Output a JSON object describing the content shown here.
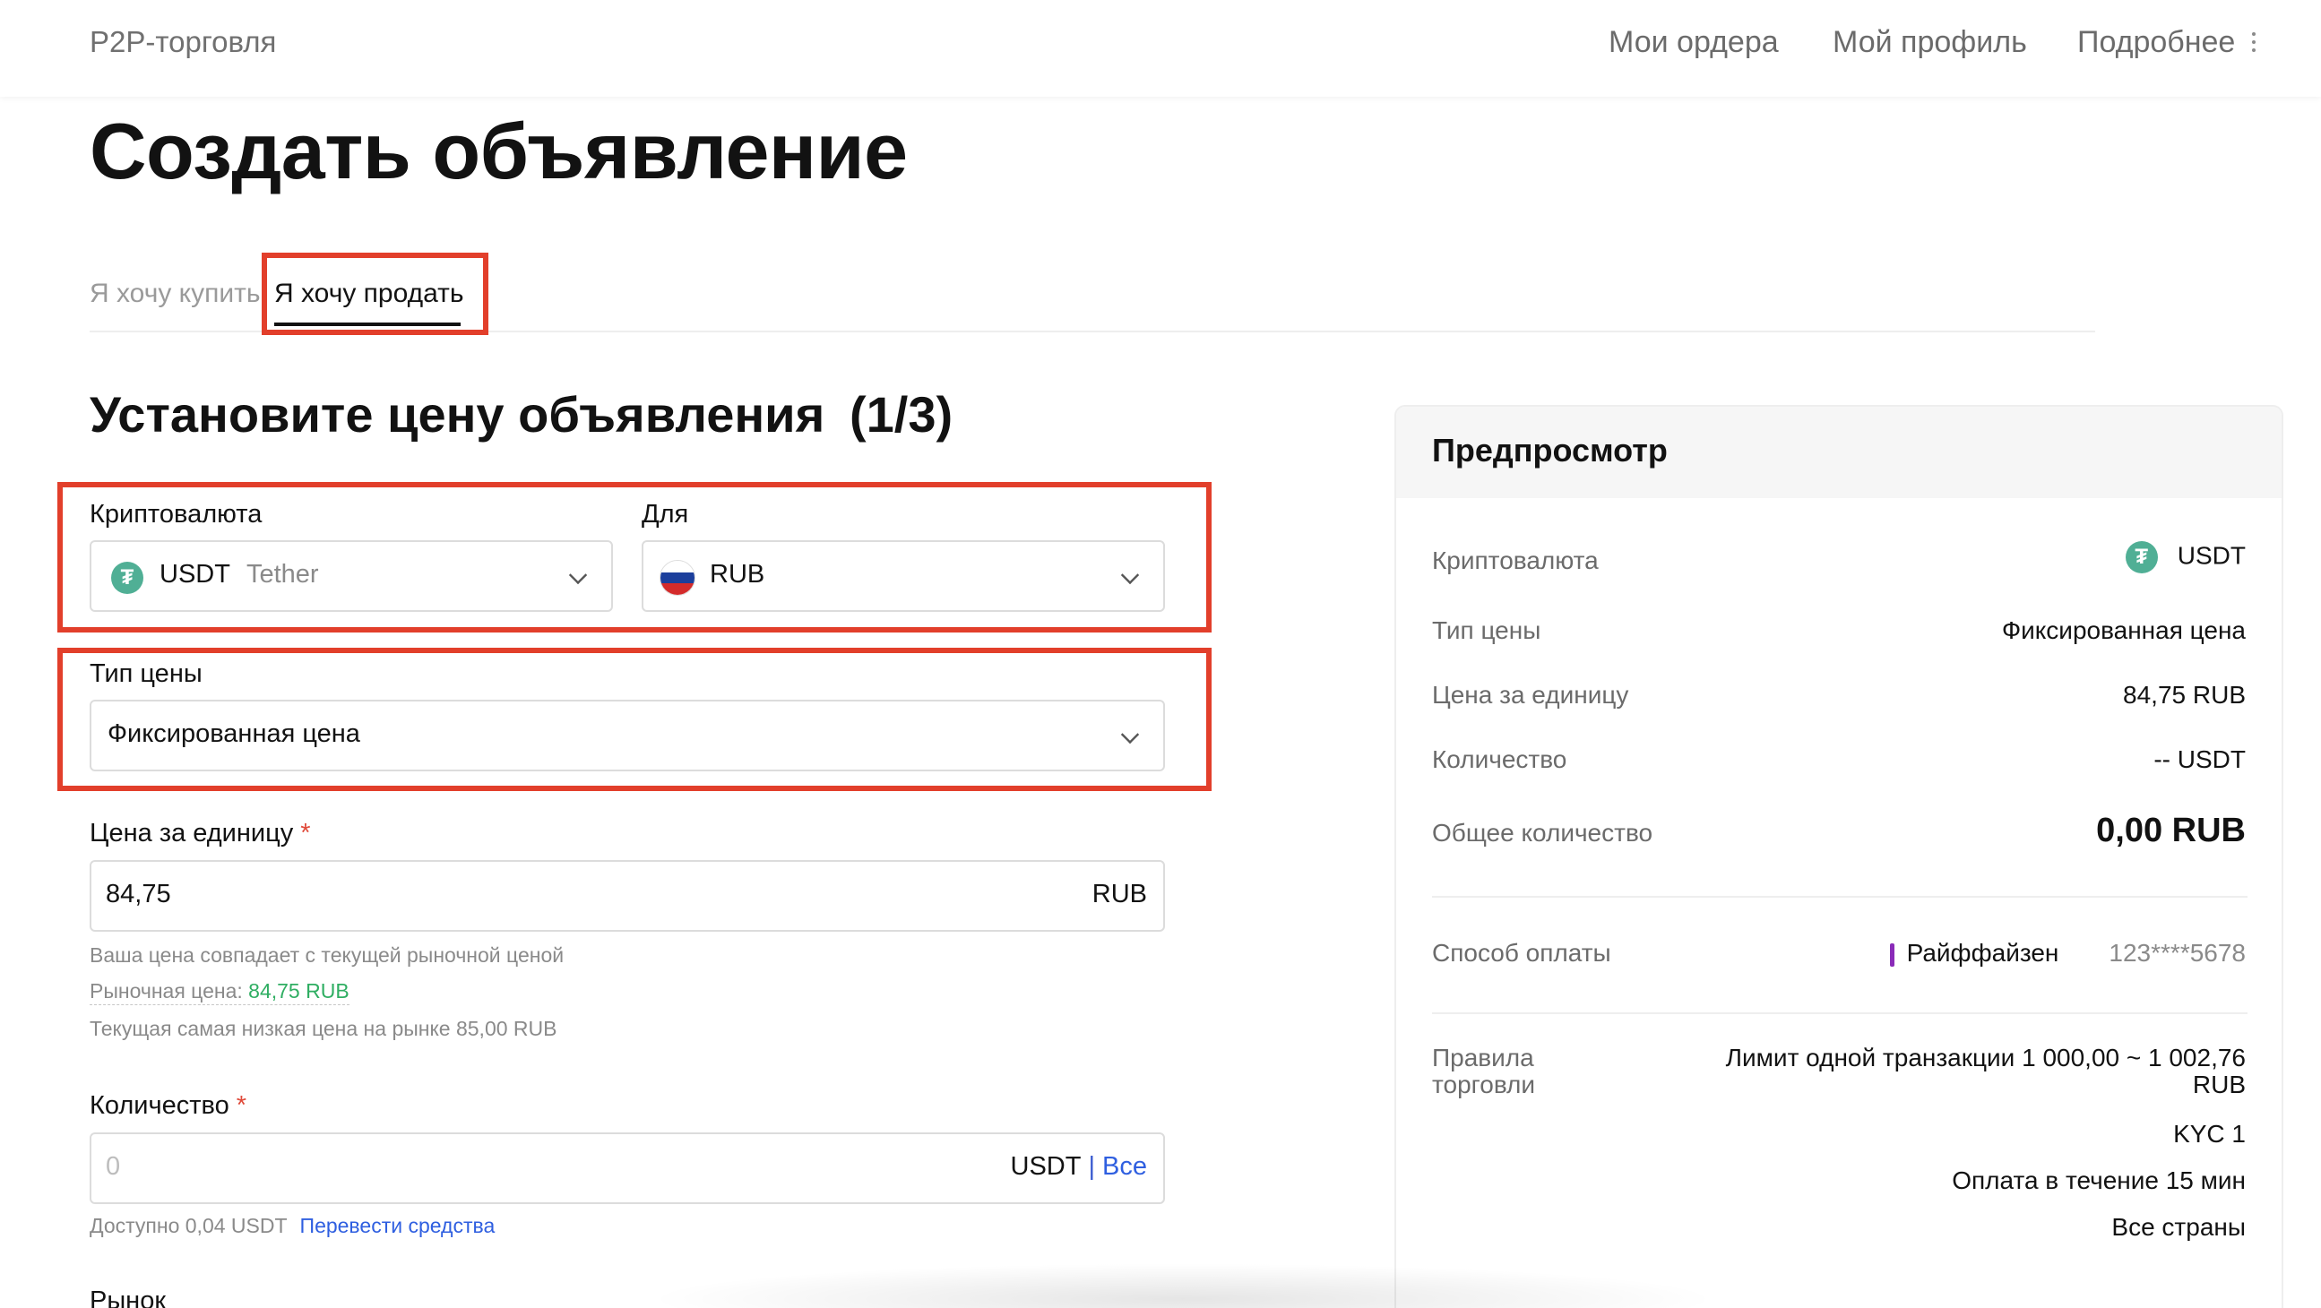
{
  "header": {
    "brand": "P2P-торговля",
    "nav": {
      "orders": "Мои ордера",
      "profile": "Мой профиль",
      "more": "Подробнее"
    }
  },
  "page_title": "Создать объявление",
  "tabs": {
    "buy": "Я хочу купить",
    "sell": "Я хочу продать",
    "active": "sell"
  },
  "step": {
    "title": "Установите цену объявления",
    "progress": "(1/3)"
  },
  "form": {
    "crypto": {
      "label": "Криптовалюта",
      "value": "USDT",
      "sub": "Tether",
      "icon": "tether-icon"
    },
    "fiat": {
      "label": "Для",
      "value": "RUB",
      "icon": "russia-flag-icon"
    },
    "price_type": {
      "label": "Тип цены",
      "value": "Фиксированная цена"
    },
    "unit_price": {
      "label": "Цена за единицу",
      "required": "*",
      "value": "84,75",
      "unit": "RUB",
      "hint_match": "Ваша цена совпадает с текущей рыночной ценой",
      "hint_market_label": "Рыночная цена: ",
      "hint_market_value": "84,75 RUB",
      "hint_lowest": "Текущая самая низкая цена на рынке 85,00 RUB"
    },
    "amount": {
      "label": "Количество",
      "required": "*",
      "placeholder": "0",
      "unit": "USDT",
      "separator": "|",
      "all": "Все",
      "available": "Доступно 0,04 USDT",
      "transfer": "Перевести средства"
    },
    "market_label": "Рынок"
  },
  "preview": {
    "title": "Предпросмотр",
    "rows": {
      "crypto_label": "Криптовалюта",
      "crypto_value": "USDT",
      "price_type_label": "Тип цены",
      "price_type_value": "Фиксированная цена",
      "unit_price_label": "Цена за единицу",
      "unit_price_value": "84,75 RUB",
      "quantity_label": "Количество",
      "quantity_value": "-- USDT",
      "total_label": "Общее количество",
      "total_value": "0,00 RUB",
      "payment_label": "Способ оплаты",
      "payment_bank": "Райффайзен",
      "payment_account": "123****5678",
      "rules_label": "Правила торговли",
      "rules_limit": "Лимит одной транзакции 1 000,00 ~ 1 002,76 RUB",
      "rules_kyc": "KYC 1",
      "rules_payment_time": "Оплата в течение 15 мин",
      "rules_countries": "Все страны"
    }
  },
  "colors": {
    "highlight": "#e23f2b",
    "tether": "#50af95",
    "link": "#2f5fe0",
    "market_price": "#2fae62",
    "bank_accent": "#8a2bb8"
  }
}
